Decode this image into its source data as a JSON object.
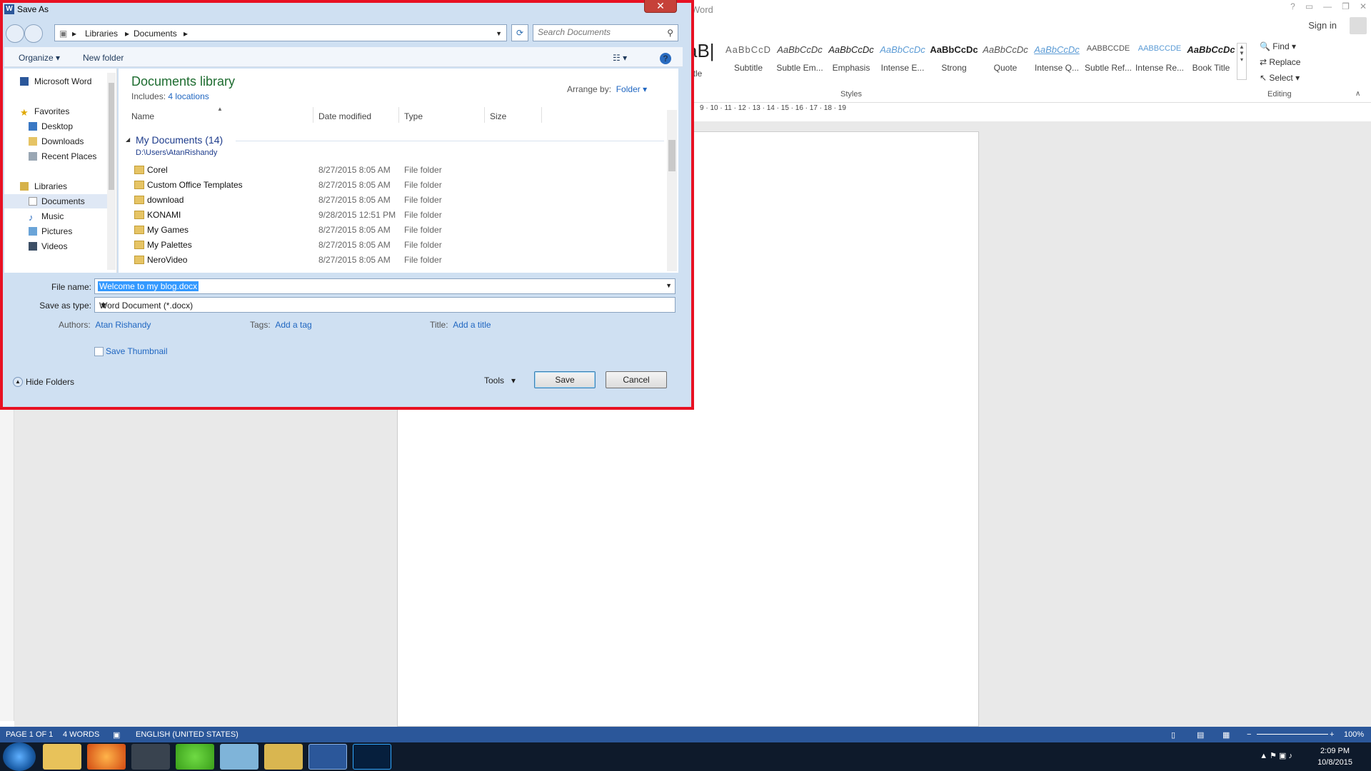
{
  "word": {
    "title": "- Word",
    "signin": "Sign in",
    "ribbon_styles_partial": "aB|",
    "styles": [
      {
        "sample": "AaBbCcD",
        "label": "Subtitle"
      },
      {
        "sample": "AaBbCcDc",
        "label": "Subtle Em..."
      },
      {
        "sample": "AaBbCcDc",
        "label": "Emphasis"
      },
      {
        "sample": "AaBbCcDc",
        "label": "Intense E..."
      },
      {
        "sample": "AaBbCcDc",
        "label": "Strong"
      },
      {
        "sample": "AaBbCcDc",
        "label": "Quote"
      },
      {
        "sample": "AaBbCcDc",
        "label": "Intense Q..."
      },
      {
        "sample": "AABBCCDE",
        "label": "Subtle Ref..."
      },
      {
        "sample": "AABBCCDE",
        "label": "Intense Re..."
      },
      {
        "sample": "AaBbCcDc",
        "label": "Book Title"
      }
    ],
    "style_partial_label": "itle",
    "styles_caption": "Styles",
    "editing_caption": "Editing",
    "find": "Find",
    "replace": "Replace",
    "select": "Select",
    "ruler_ticks": "9 · 10 · 11 · 12 · 13 · 14 · 15 · 16 · 17 · 18 · 19",
    "status": {
      "page": "PAGE 1 OF 1",
      "words": "4 WORDS",
      "language": "ENGLISH (UNITED STATES)",
      "zoom": "100%"
    }
  },
  "taskbar": {
    "time": "2:09 PM",
    "date": "10/8/2015",
    "apps": [
      "Windows Explorer",
      "Firefox",
      "Notepad",
      "Upwork",
      "Notes",
      "File Manager",
      "Word",
      "Photoshop"
    ]
  },
  "dialog": {
    "title": "Save As",
    "close": "✕",
    "address": [
      "Libraries",
      "Documents"
    ],
    "search_placeholder": "Search Documents",
    "organize": "Organize",
    "new_folder": "New folder",
    "nav": {
      "word": "Microsoft Word",
      "favorites": "Favorites",
      "desktop": "Desktop",
      "downloads": "Downloads",
      "recent": "Recent Places",
      "libraries": "Libraries",
      "documents": "Documents",
      "music": "Music",
      "pictures": "Pictures",
      "videos": "Videos"
    },
    "library_title": "Documents library",
    "includes_label": "Includes:",
    "includes_link": "4 locations",
    "arrange_label": "Arrange by:",
    "arrange_value": "Folder",
    "columns": {
      "name": "Name",
      "date": "Date modified",
      "type": "Type",
      "size": "Size"
    },
    "group_title": "My Documents (14)",
    "group_path": "D:\\Users\\AtanRishandy",
    "files": [
      {
        "name": "Corel",
        "date": "8/27/2015 8:05 AM",
        "type": "File folder"
      },
      {
        "name": "Custom Office Templates",
        "date": "8/27/2015 8:05 AM",
        "type": "File folder"
      },
      {
        "name": "download",
        "date": "8/27/2015 8:05 AM",
        "type": "File folder"
      },
      {
        "name": "KONAMI",
        "date": "9/28/2015 12:51 PM",
        "type": "File folder"
      },
      {
        "name": "My Games",
        "date": "8/27/2015 8:05 AM",
        "type": "File folder"
      },
      {
        "name": "My Palettes",
        "date": "8/27/2015 8:05 AM",
        "type": "File folder"
      },
      {
        "name": "NeroVideo",
        "date": "8/27/2015 8:05 AM",
        "type": "File folder"
      }
    ],
    "filename_label": "File name:",
    "filename_value": "Welcome to my blog.docx",
    "savetype_label": "Save as type:",
    "savetype_value": "Word Document (*.docx)",
    "authors_label": "Authors:",
    "authors_value": "Atan Rishandy",
    "tags_label": "Tags:",
    "tags_value": "Add a tag",
    "title_label": "Title:",
    "title_value": "Add a title",
    "save_thumbnail": "Save Thumbnail",
    "hide_folders": "Hide Folders",
    "tools": "Tools",
    "save": "Save",
    "cancel": "Cancel"
  }
}
